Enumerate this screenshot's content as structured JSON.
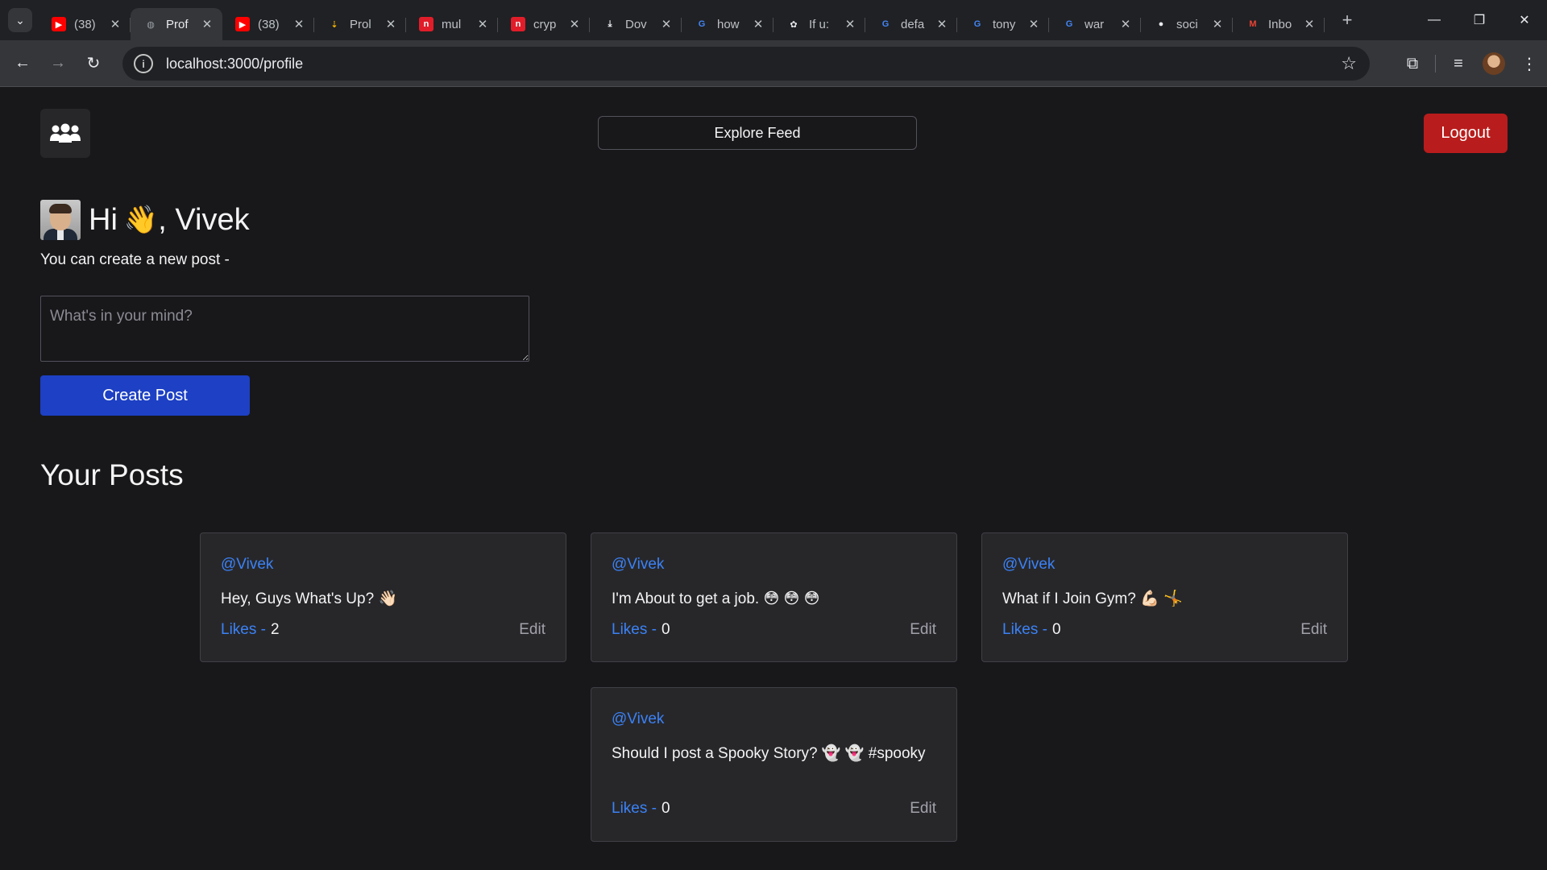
{
  "browser": {
    "tabs": [
      {
        "title": "(38)",
        "favicon": "youtube-icon",
        "color": "#ff0000",
        "active": false
      },
      {
        "title": "Prof",
        "favicon": "globe-icon",
        "color": "#9aa0a6",
        "active": true
      },
      {
        "title": "(38)",
        "favicon": "youtube-icon",
        "color": "#ff0000",
        "active": false
      },
      {
        "title": "Prol",
        "favicon": "download-arrow-icon",
        "color": "#f4b400",
        "active": false
      },
      {
        "title": "mul",
        "favicon": "n-icon",
        "color": "#e11d2a",
        "active": false
      },
      {
        "title": "cryp",
        "favicon": "n-icon",
        "color": "#e11d2a",
        "active": false
      },
      {
        "title": "Dov",
        "favicon": "download-icon",
        "color": "#e8eaed",
        "active": false
      },
      {
        "title": "how",
        "favicon": "google-icon",
        "color": "#4285f4",
        "active": false
      },
      {
        "title": "If u:",
        "favicon": "openai-icon",
        "color": "#e8eaed",
        "active": false
      },
      {
        "title": "defa",
        "favicon": "google-icon",
        "color": "#4285f4",
        "active": false
      },
      {
        "title": "tony",
        "favicon": "google-icon",
        "color": "#4285f4",
        "active": false
      },
      {
        "title": "war",
        "favicon": "google-icon",
        "color": "#4285f4",
        "active": false
      },
      {
        "title": "soci",
        "favicon": "github-icon",
        "color": "#e8eaed",
        "active": false
      },
      {
        "title": "Inbo",
        "favicon": "gmail-icon",
        "color": "#ea4335",
        "active": false
      }
    ],
    "url": "localhost:3000/profile"
  },
  "header": {
    "explore_label": "Explore Feed",
    "logout_label": "Logout",
    "logo_icon": "users-group-icon"
  },
  "greeting": {
    "hi": "Hi",
    "wave": "👋",
    "name": ", Vivek"
  },
  "create": {
    "subtext": "You can create a new post -",
    "placeholder": "What's in your mind?",
    "button_label": "Create Post"
  },
  "posts_heading": "Your Posts",
  "posts": [
    {
      "author": "@Vivek",
      "text": "Hey, Guys What's Up? 👋🏻",
      "likes_label": "Likes -",
      "likes": "2",
      "edit_label": "Edit"
    },
    {
      "author": "@Vivek",
      "text": "I'm About to get a job. 😳 😳 😳",
      "likes_label": "Likes -",
      "likes": "0",
      "edit_label": "Edit"
    },
    {
      "author": "@Vivek",
      "text": "What if I Join Gym? 💪🏻 🤸",
      "likes_label": "Likes -",
      "likes": "0",
      "edit_label": "Edit"
    },
    {
      "author": "@Vivek",
      "text": "Should I post a Spooky Story? 👻 👻 #spooky",
      "likes_label": "Likes -",
      "likes": "0",
      "edit_label": "Edit"
    }
  ],
  "colors": {
    "background": "#18181b",
    "card": "#27272a",
    "accent_blue": "#3b82f6",
    "primary_button": "#1d40c4",
    "logout_button": "#b91c1c"
  }
}
